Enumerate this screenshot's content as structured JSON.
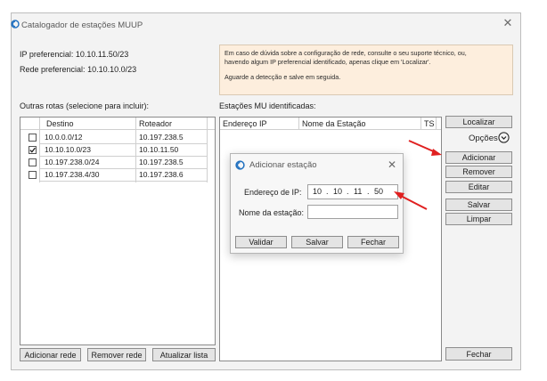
{
  "window": {
    "title": "Catalogador de estações MUUP"
  },
  "network": {
    "ip_pref_label": "IP preferencial:",
    "ip_pref_value": "10.10.11.50/23",
    "rede_pref_label": "Rede preferencial:",
    "rede_pref_value": "10.10.10.0/23"
  },
  "info": {
    "line1": "Em caso de dúvida sobre a configuração de rede, consulte o seu suporte técnico, ou,",
    "line2": "havendo algum IP preferencial identificado, apenas clique em 'Localizar'.",
    "line3": "Aguarde a detecção e salve em seguida."
  },
  "routes": {
    "heading": "Outras rotas (selecione para incluir):",
    "columns": [
      "Destino",
      "Roteador"
    ],
    "rows": [
      {
        "destino": "10.0.0.0/12",
        "roteador": "10.197.238.5",
        "checked": false
      },
      {
        "destino": "10.10.10.0/23",
        "roteador": "10.10.11.50",
        "checked": true
      },
      {
        "destino": "10.197.238.0/24",
        "roteador": "10.197.238.5",
        "checked": false
      },
      {
        "destino": "10.197.238.4/30",
        "roteador": "10.197.238.6",
        "checked": false
      }
    ],
    "buttons": {
      "add": "Adicionar rede",
      "remove": "Remover rede",
      "update": "Atualizar lista"
    }
  },
  "stations": {
    "heading": "Estações MU identificadas:",
    "columns": [
      "Endereço IP",
      "Nome da Estação",
      "TS"
    ]
  },
  "side_buttons": {
    "localizar": "Localizar",
    "opcoes": "Opções",
    "adicionar": "Adicionar",
    "remover": "Remover",
    "editar": "Editar",
    "salvar": "Salvar",
    "limpar": "Limpar",
    "fechar": "Fechar"
  },
  "dialog": {
    "title": "Adicionar estação",
    "ip_label": "Endereço de IP:",
    "ip_octets": [
      "10",
      "10",
      "11",
      "50"
    ],
    "ip_sep": ".",
    "name_label": "Nome da estação:",
    "name_value": "",
    "buttons": {
      "validar": "Validar",
      "salvar": "Salvar",
      "fechar": "Fechar"
    }
  },
  "icons": {
    "app": "app-logo-icon",
    "close": "close-icon",
    "options": "chevron-down-circle-icon"
  },
  "colors": {
    "info_bg": "#fdeedd",
    "accent_blue": "#1f6fbf",
    "annotation_red": "#e02020"
  }
}
